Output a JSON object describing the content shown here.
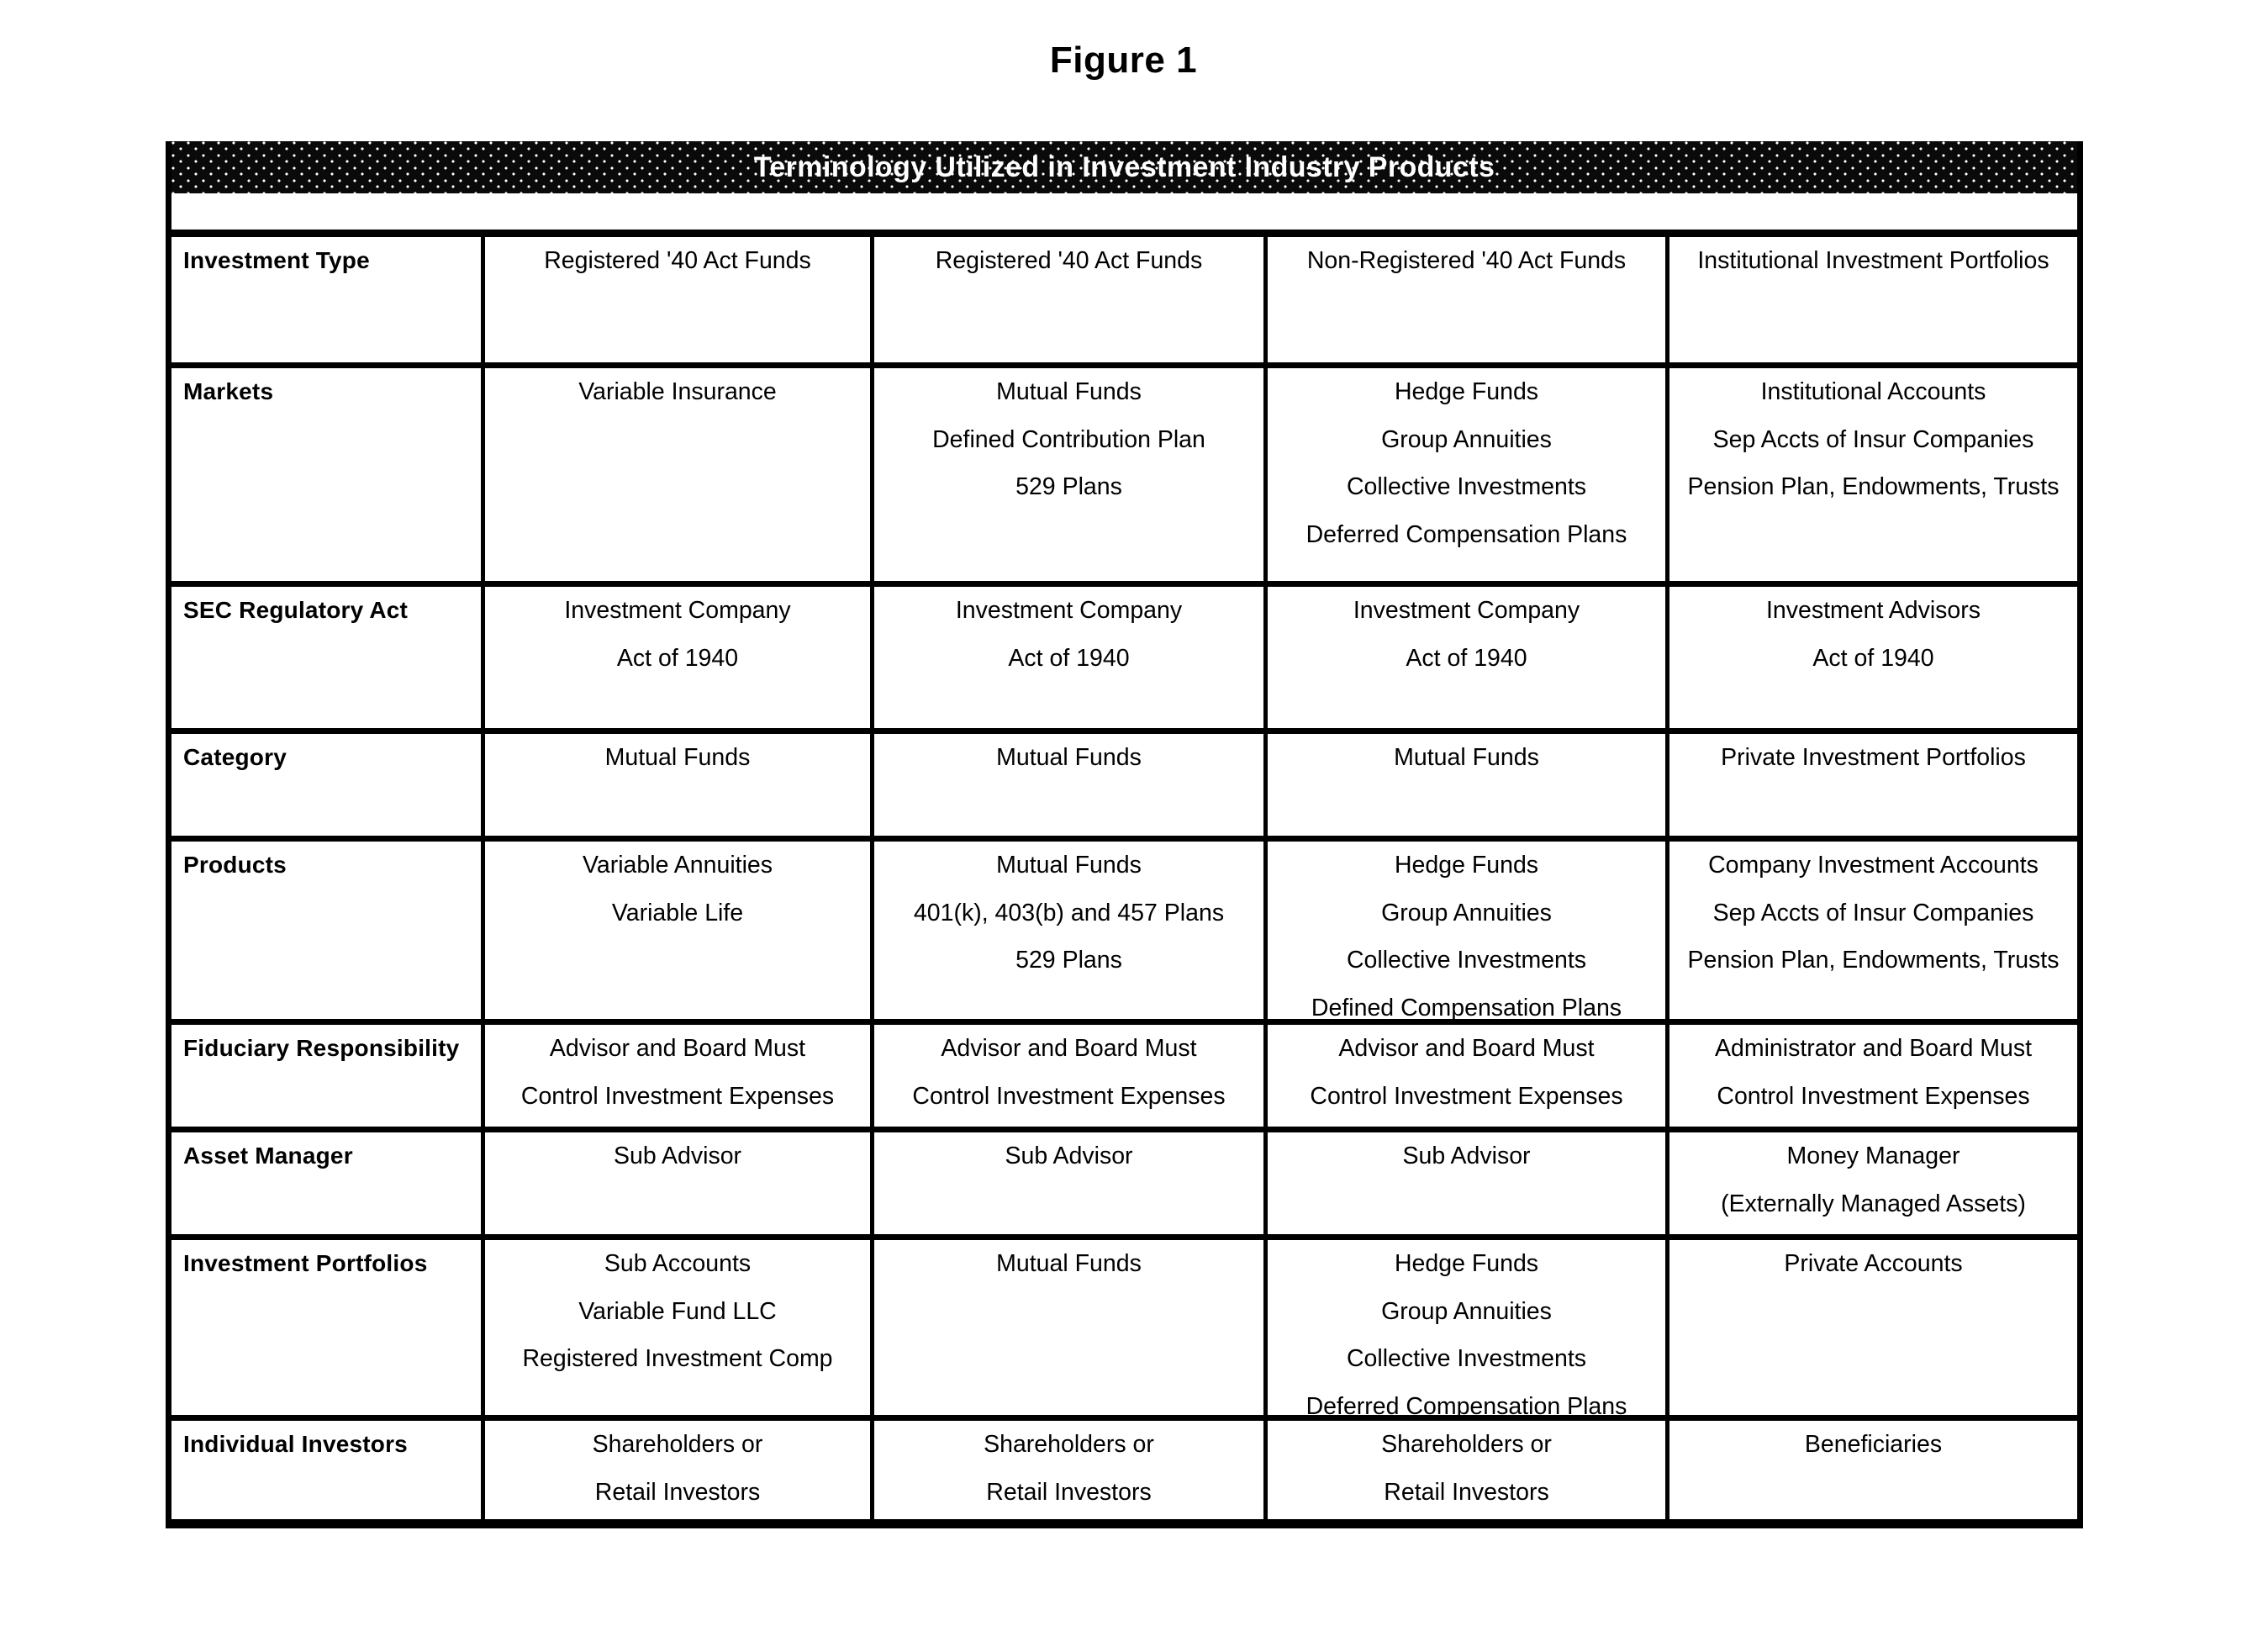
{
  "figure": {
    "caption": "Figure 1",
    "banner_title": "Terminology Utilized in Investment Industry Products"
  },
  "table": {
    "rows": [
      {
        "label": "Investment Type",
        "cells": [
          [
            "Registered '40 Act Funds"
          ],
          [
            "Registered '40 Act Funds"
          ],
          [
            "Non-Registered '40 Act Funds"
          ],
          [
            "Institutional Investment Portfolios"
          ]
        ]
      },
      {
        "label": "Markets",
        "cells": [
          [
            "Variable Insurance"
          ],
          [
            "Mutual Funds",
            "Defined Contribution Plan",
            "529 Plans"
          ],
          [
            "Hedge Funds",
            "Group Annuities",
            "Collective Investments",
            "Deferred Compensation Plans"
          ],
          [
            "Institutional Accounts",
            "Sep Accts of Insur Companies",
            "Pension Plan, Endowments, Trusts"
          ]
        ]
      },
      {
        "label": "SEC Regulatory Act",
        "cells": [
          [
            "Investment Company",
            "Act of 1940"
          ],
          [
            "Investment Company",
            "Act of 1940"
          ],
          [
            "Investment Company",
            "Act of 1940"
          ],
          [
            "Investment Advisors",
            "Act of 1940"
          ]
        ]
      },
      {
        "label": "Category",
        "cells": [
          [
            "Mutual Funds"
          ],
          [
            "Mutual Funds"
          ],
          [
            "Mutual Funds"
          ],
          [
            "Private Investment Portfolios"
          ]
        ]
      },
      {
        "label": "Products",
        "cells": [
          [
            "Variable Annuities",
            "Variable Life"
          ],
          [
            "Mutual Funds",
            "401(k), 403(b) and 457 Plans",
            "529 Plans"
          ],
          [
            "Hedge Funds",
            "Group Annuities",
            "Collective Investments",
            "Defined Compensation Plans"
          ],
          [
            "Company Investment Accounts",
            "Sep Accts of Insur Companies",
            "Pension Plan, Endowments, Trusts"
          ]
        ]
      },
      {
        "label": "Fiduciary Responsibility",
        "cells": [
          [
            "Advisor and Board Must",
            "Control Investment Expenses"
          ],
          [
            "Advisor and Board Must",
            "Control Investment Expenses"
          ],
          [
            "Advisor and Board Must",
            "Control Investment Expenses"
          ],
          [
            "Administrator and Board Must",
            "Control Investment Expenses"
          ]
        ]
      },
      {
        "label": "Asset Manager",
        "cells": [
          [
            "Sub Advisor"
          ],
          [
            "Sub Advisor"
          ],
          [
            "Sub Advisor"
          ],
          [
            "Money Manager",
            "(Externally Managed Assets)"
          ]
        ]
      },
      {
        "label": "Investment Portfolios",
        "cells": [
          [
            "Sub Accounts",
            "Variable Fund LLC",
            "Registered Investment Comp"
          ],
          [
            "Mutual Funds"
          ],
          [
            "Hedge Funds",
            "Group Annuities",
            "Collective Investments",
            "Deferred Compensation Plans"
          ],
          [
            "Private Accounts"
          ]
        ]
      },
      {
        "label": "Individual Investors",
        "cells": [
          [
            "Shareholders or",
            "Retail Investors"
          ],
          [
            "Shareholders or",
            "Retail Investors"
          ],
          [
            "Shareholders or",
            "Retail Investors"
          ],
          [
            "Beneficiaries"
          ]
        ]
      }
    ]
  },
  "colors": {
    "banner_bg": "#0a0a0a",
    "banner_text": "#ffffff",
    "rule": "#000000",
    "page_bg": "#ffffff"
  }
}
